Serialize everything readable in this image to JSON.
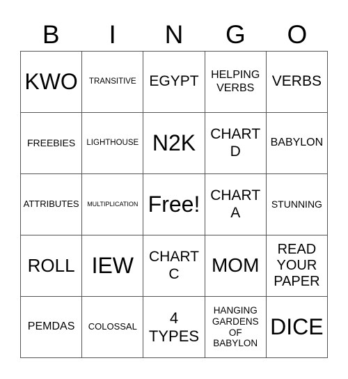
{
  "header": [
    "B",
    "I",
    "N",
    "G",
    "O"
  ],
  "cells": [
    [
      "KWO",
      "TRANSITIVE",
      "EGYPT",
      "HELPING VERBS",
      "VERBS"
    ],
    [
      "FREEBIES",
      "LIGHTHOUSE",
      "N2K",
      "CHART D",
      "BABYLON"
    ],
    [
      "ATTRIBUTES",
      "MULTIPLICATION",
      "Free!",
      "CHART A",
      "STUNNING"
    ],
    [
      "ROLL",
      "IEW",
      "CHART C",
      "MOM",
      "READ YOUR PAPER"
    ],
    [
      "PEMDAS",
      "COLOSSAL",
      "4 TYPES",
      "HANGING GARDENS OF BABYLON",
      "DICE"
    ]
  ]
}
